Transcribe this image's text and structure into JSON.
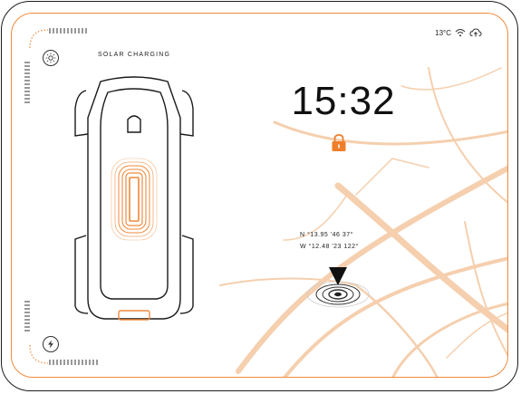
{
  "status": {
    "temperature": "13°C",
    "wifi_icon": "wifi-icon",
    "cloud_icon": "cloud-upload-icon"
  },
  "header": {
    "mode_label": "SOLAR CHARGING"
  },
  "clock": {
    "time": "15:32"
  },
  "lock": {
    "icon": "lock-icon",
    "color": "#ef7f2a"
  },
  "coordinates": {
    "north": "N °13.95 '46 37°",
    "west": "W °12.48 '23 122°"
  },
  "colors": {
    "accent": "#ef8a3c",
    "outline": "#1c1c1c",
    "road": "#f5cfae"
  },
  "icons": {
    "sun": "sun-icon",
    "charge": "lightning-icon",
    "location": "location-marker-icon"
  }
}
